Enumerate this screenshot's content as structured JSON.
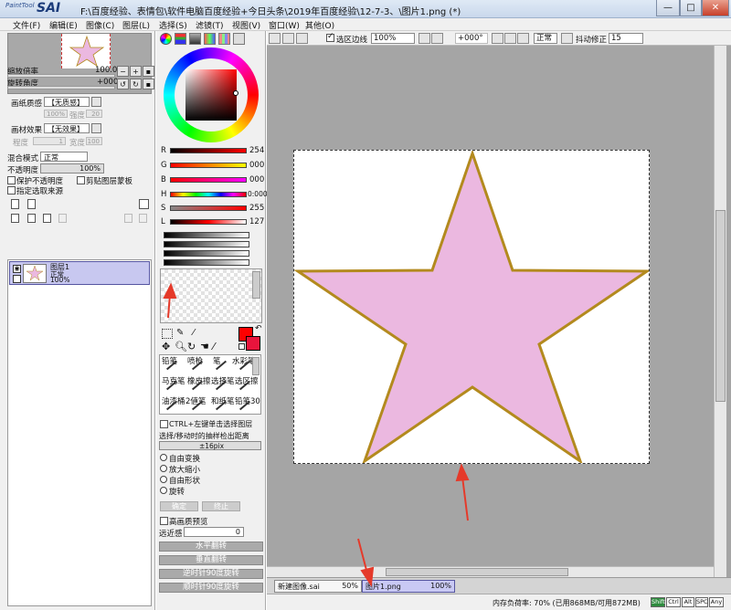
{
  "window": {
    "logo_small": "PaintTool",
    "logo_big": "SAI",
    "title": "F:\\百度经验、表情包\\软件电脑百度经验+今日头条\\2019年百度经验\\12-7-3、\\图片1.png (*)",
    "btn_min": "—",
    "btn_max": "□",
    "btn_close": "✕"
  },
  "menu": [
    "文件(F)",
    "编辑(E)",
    "图像(C)",
    "图层(L)",
    "选择(S)",
    "滤镜(T)",
    "视图(V)",
    "窗口(W)",
    "其他(O)"
  ],
  "navigator": {
    "zoom_label": "缩放倍率",
    "zoom_value": "100.0%",
    "rotate_label": "旋转角度",
    "rotate_value": "+000"
  },
  "paper_texture": {
    "label": "画纸质感",
    "value": "【无质感】",
    "scale_value": "100%",
    "strength_label": "强度",
    "strength_value": "20"
  },
  "paper_effect": {
    "label": "画材效果",
    "value": "【无效果】",
    "level_label": "程度",
    "level_value": "1",
    "width_label": "宽度",
    "width_value": "100"
  },
  "blend": {
    "label": "混合模式",
    "value": "正常"
  },
  "opacity": {
    "label": "不透明度",
    "value": "100%"
  },
  "checks": {
    "protect_opacity": "保护不透明度",
    "clip": "剪贴图层蒙板",
    "selection_source": "指定选取来源"
  },
  "layer": {
    "name": "图层1",
    "mode": "正常",
    "opacity": "100%"
  },
  "color": {
    "r_label": "R",
    "r_value": "254",
    "g_label": "G",
    "g_value": "000",
    "b_label": "B",
    "b_value": "000",
    "h_label": "H",
    "h_value": "0:000",
    "s_label": "S",
    "s_value": "255",
    "l_label": "L",
    "l_value": "127",
    "primary": "#fe0000"
  },
  "tools": {
    "row1": [
      "铅笔",
      "喷枪",
      "笔",
      "水彩笔"
    ],
    "row2": [
      "马克笔",
      "橡皮擦",
      "选择笔",
      "选区擦"
    ],
    "row3": [
      "油漆桶",
      "2値笔",
      "和纸笔",
      "铅笔30"
    ]
  },
  "options": {
    "ctrl_click": "CTRL+左键单击选择图层",
    "move_label": "选择/移动时的抽样检出距离",
    "move_value": "±16pix",
    "free_transform": "自由变换",
    "scale": "放大缩小",
    "free_shape": "自由形状",
    "rotate": "旋转",
    "ok": "确定",
    "cancel": "终止",
    "hq_preview": "高画质预览",
    "distance_label": "远近感",
    "distance_value": "0",
    "flip_h": "水平翻转",
    "flip_v": "垂直翻转",
    "rot_ccw": "逆时针90度旋转",
    "rot_cw": "顺时针90度旋转"
  },
  "canvas_toolbar": {
    "select_edge": "选区边线",
    "zoom": "100%",
    "angle": "+000°",
    "mode": "正常",
    "stabilizer_label": "抖动修正",
    "stabilizer_value": "15"
  },
  "tabs": [
    {
      "name": "新建图像.sai",
      "zoom": "50%"
    },
    {
      "name": "图片1.png",
      "zoom": "100%"
    }
  ],
  "status": {
    "memory": "内存负荷率: 70% (已用868MB/可用872MB)",
    "indicators": [
      "Shift",
      "Ctrl",
      "Alt",
      "SPC",
      "Any"
    ]
  },
  "star": {
    "fill": "#ebb8e0",
    "stroke": "#b38a1e"
  }
}
